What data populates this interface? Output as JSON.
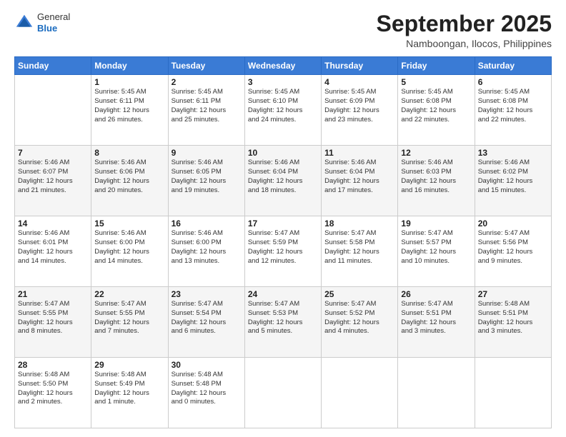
{
  "logo": {
    "general": "General",
    "blue": "Blue"
  },
  "header": {
    "month": "September 2025",
    "location": "Namboongan, Ilocos, Philippines"
  },
  "weekdays": [
    "Sunday",
    "Monday",
    "Tuesday",
    "Wednesday",
    "Thursday",
    "Friday",
    "Saturday"
  ],
  "weeks": [
    [
      {
        "day": "",
        "info": ""
      },
      {
        "day": "1",
        "info": "Sunrise: 5:45 AM\nSunset: 6:11 PM\nDaylight: 12 hours\nand 26 minutes."
      },
      {
        "day": "2",
        "info": "Sunrise: 5:45 AM\nSunset: 6:11 PM\nDaylight: 12 hours\nand 25 minutes."
      },
      {
        "day": "3",
        "info": "Sunrise: 5:45 AM\nSunset: 6:10 PM\nDaylight: 12 hours\nand 24 minutes."
      },
      {
        "day": "4",
        "info": "Sunrise: 5:45 AM\nSunset: 6:09 PM\nDaylight: 12 hours\nand 23 minutes."
      },
      {
        "day": "5",
        "info": "Sunrise: 5:45 AM\nSunset: 6:08 PM\nDaylight: 12 hours\nand 22 minutes."
      },
      {
        "day": "6",
        "info": "Sunrise: 5:45 AM\nSunset: 6:08 PM\nDaylight: 12 hours\nand 22 minutes."
      }
    ],
    [
      {
        "day": "7",
        "info": "Sunrise: 5:46 AM\nSunset: 6:07 PM\nDaylight: 12 hours\nand 21 minutes."
      },
      {
        "day": "8",
        "info": "Sunrise: 5:46 AM\nSunset: 6:06 PM\nDaylight: 12 hours\nand 20 minutes."
      },
      {
        "day": "9",
        "info": "Sunrise: 5:46 AM\nSunset: 6:05 PM\nDaylight: 12 hours\nand 19 minutes."
      },
      {
        "day": "10",
        "info": "Sunrise: 5:46 AM\nSunset: 6:04 PM\nDaylight: 12 hours\nand 18 minutes."
      },
      {
        "day": "11",
        "info": "Sunrise: 5:46 AM\nSunset: 6:04 PM\nDaylight: 12 hours\nand 17 minutes."
      },
      {
        "day": "12",
        "info": "Sunrise: 5:46 AM\nSunset: 6:03 PM\nDaylight: 12 hours\nand 16 minutes."
      },
      {
        "day": "13",
        "info": "Sunrise: 5:46 AM\nSunset: 6:02 PM\nDaylight: 12 hours\nand 15 minutes."
      }
    ],
    [
      {
        "day": "14",
        "info": "Sunrise: 5:46 AM\nSunset: 6:01 PM\nDaylight: 12 hours\nand 14 minutes."
      },
      {
        "day": "15",
        "info": "Sunrise: 5:46 AM\nSunset: 6:00 PM\nDaylight: 12 hours\nand 14 minutes."
      },
      {
        "day": "16",
        "info": "Sunrise: 5:46 AM\nSunset: 6:00 PM\nDaylight: 12 hours\nand 13 minutes."
      },
      {
        "day": "17",
        "info": "Sunrise: 5:47 AM\nSunset: 5:59 PM\nDaylight: 12 hours\nand 12 minutes."
      },
      {
        "day": "18",
        "info": "Sunrise: 5:47 AM\nSunset: 5:58 PM\nDaylight: 12 hours\nand 11 minutes."
      },
      {
        "day": "19",
        "info": "Sunrise: 5:47 AM\nSunset: 5:57 PM\nDaylight: 12 hours\nand 10 minutes."
      },
      {
        "day": "20",
        "info": "Sunrise: 5:47 AM\nSunset: 5:56 PM\nDaylight: 12 hours\nand 9 minutes."
      }
    ],
    [
      {
        "day": "21",
        "info": "Sunrise: 5:47 AM\nSunset: 5:55 PM\nDaylight: 12 hours\nand 8 minutes."
      },
      {
        "day": "22",
        "info": "Sunrise: 5:47 AM\nSunset: 5:55 PM\nDaylight: 12 hours\nand 7 minutes."
      },
      {
        "day": "23",
        "info": "Sunrise: 5:47 AM\nSunset: 5:54 PM\nDaylight: 12 hours\nand 6 minutes."
      },
      {
        "day": "24",
        "info": "Sunrise: 5:47 AM\nSunset: 5:53 PM\nDaylight: 12 hours\nand 5 minutes."
      },
      {
        "day": "25",
        "info": "Sunrise: 5:47 AM\nSunset: 5:52 PM\nDaylight: 12 hours\nand 4 minutes."
      },
      {
        "day": "26",
        "info": "Sunrise: 5:47 AM\nSunset: 5:51 PM\nDaylight: 12 hours\nand 3 minutes."
      },
      {
        "day": "27",
        "info": "Sunrise: 5:48 AM\nSunset: 5:51 PM\nDaylight: 12 hours\nand 3 minutes."
      }
    ],
    [
      {
        "day": "28",
        "info": "Sunrise: 5:48 AM\nSunset: 5:50 PM\nDaylight: 12 hours\nand 2 minutes."
      },
      {
        "day": "29",
        "info": "Sunrise: 5:48 AM\nSunset: 5:49 PM\nDaylight: 12 hours\nand 1 minute."
      },
      {
        "day": "30",
        "info": "Sunrise: 5:48 AM\nSunset: 5:48 PM\nDaylight: 12 hours\nand 0 minutes."
      },
      {
        "day": "",
        "info": ""
      },
      {
        "day": "",
        "info": ""
      },
      {
        "day": "",
        "info": ""
      },
      {
        "day": "",
        "info": ""
      }
    ]
  ]
}
